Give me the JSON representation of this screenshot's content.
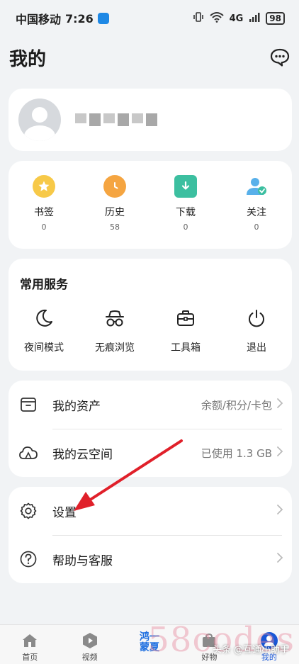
{
  "status_bar": {
    "carrier": "中国移动",
    "time": "7:26",
    "network": "4G",
    "battery": "98"
  },
  "header": {
    "title": "我的",
    "chat_icon": "chat-bubble-icon"
  },
  "quick_links": [
    {
      "label": "书签",
      "count": "0",
      "icon": "star-icon",
      "color": "#f7c948"
    },
    {
      "label": "历史",
      "count": "58",
      "icon": "clock-icon",
      "color": "#f5a541"
    },
    {
      "label": "下载",
      "count": "0",
      "icon": "download-icon",
      "color": "#3cbfa0"
    },
    {
      "label": "关注",
      "count": "0",
      "icon": "follow-icon",
      "color": "#58b0ea"
    }
  ],
  "services": {
    "title": "常用服务",
    "items": [
      {
        "label": "夜间模式",
        "icon": "moon-icon"
      },
      {
        "label": "无痕浏览",
        "icon": "incognito-icon"
      },
      {
        "label": "工具箱",
        "icon": "toolbox-icon"
      },
      {
        "label": "退出",
        "icon": "power-icon"
      }
    ]
  },
  "account_list": [
    {
      "label": "我的资产",
      "value": "余额/积分/卡包",
      "icon": "wallet-icon"
    },
    {
      "label": "我的云空间",
      "value": "已使用 1.3 GB",
      "icon": "cloud-icon"
    }
  ],
  "settings_list": [
    {
      "label": "设置",
      "icon": "gear-icon"
    },
    {
      "label": "帮助与客服",
      "icon": "help-icon"
    }
  ],
  "bottom_nav": [
    {
      "label": "首页",
      "icon": "home-icon"
    },
    {
      "label": "视频",
      "icon": "video-icon"
    },
    {
      "label": "鸿一蒙夏",
      "icon": "hongmeng-icon"
    },
    {
      "label": "好物",
      "icon": "goods-icon"
    },
    {
      "label": "我的",
      "icon": "profile-icon"
    }
  ],
  "colors": {
    "accent": "#1a57d6",
    "annotation_arrow": "#e0202a"
  },
  "watermarks": {
    "site": "58codes",
    "author": "头条 @互通小助手"
  }
}
